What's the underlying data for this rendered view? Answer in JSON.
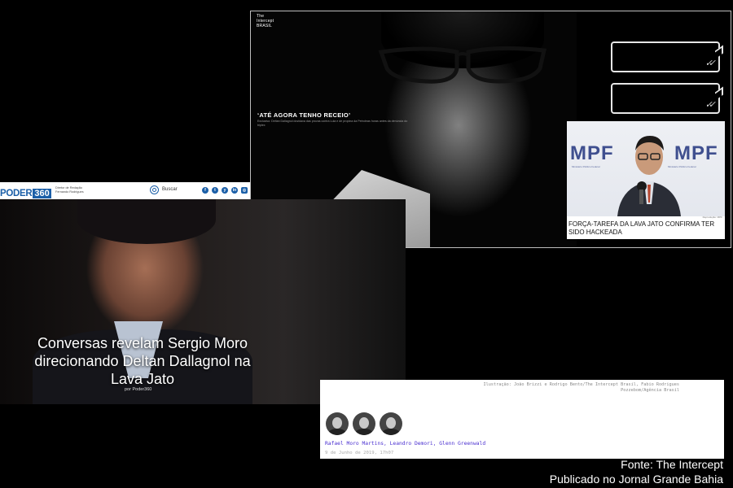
{
  "intercept": {
    "logo_line1": "The",
    "logo_line2": "Intercept",
    "logo_line3": "BRASIL",
    "headline": "‘ATÉ AGORA TENHO RECEIO’",
    "subline": "Exclusivo: Deltan Dallagnol duvidava das provas contra Lula e de propina da Petrobras horas antes da denúncia do triplex",
    "bubble_check": "✓✓",
    "mpf_card": {
      "logo_text": "MPF",
      "logo_sub": "Ministério Público Federal",
      "credit": "Reprodução: MPF",
      "caption": "FORÇA-TAREFA DA LAVA JATO CONFIRMA TER SIDO HACKEADA"
    }
  },
  "poder": {
    "logo_word": "PODER",
    "logo_num": "360",
    "editor_role": "Diretor de Redação",
    "editor_name": "Fernando Rodrigues",
    "search_label": "Buscar",
    "social_icons": [
      "f",
      "t",
      "y",
      "in",
      "▶",
      "◎"
    ],
    "headline": "Conversas revelam Sergio Moro direcionando Deltan Dallagnol na Lava Jato",
    "byline": "por Poder360"
  },
  "byline_panel": {
    "credit_line1": "Ilustração: João Brizzi e Rodrigo Bento/The Intercept Brasil, Fabio Rodrigues",
    "credit_line2": "Pozzebom/Agência Brasil",
    "authors": "Rafael Moro Martins, Leandro Demori, Glenn Greenwald",
    "date": "9 de Junho de 2019, 17h07"
  },
  "footer": {
    "line1": "Fonte: The Intercept",
    "line2": "Publicado no Jornal Grande Bahia"
  },
  "colors": {
    "poder_blue": "#1b5fa8",
    "author_purple": "#4a2fd0",
    "mpf_blue": "#3f4f8f"
  }
}
